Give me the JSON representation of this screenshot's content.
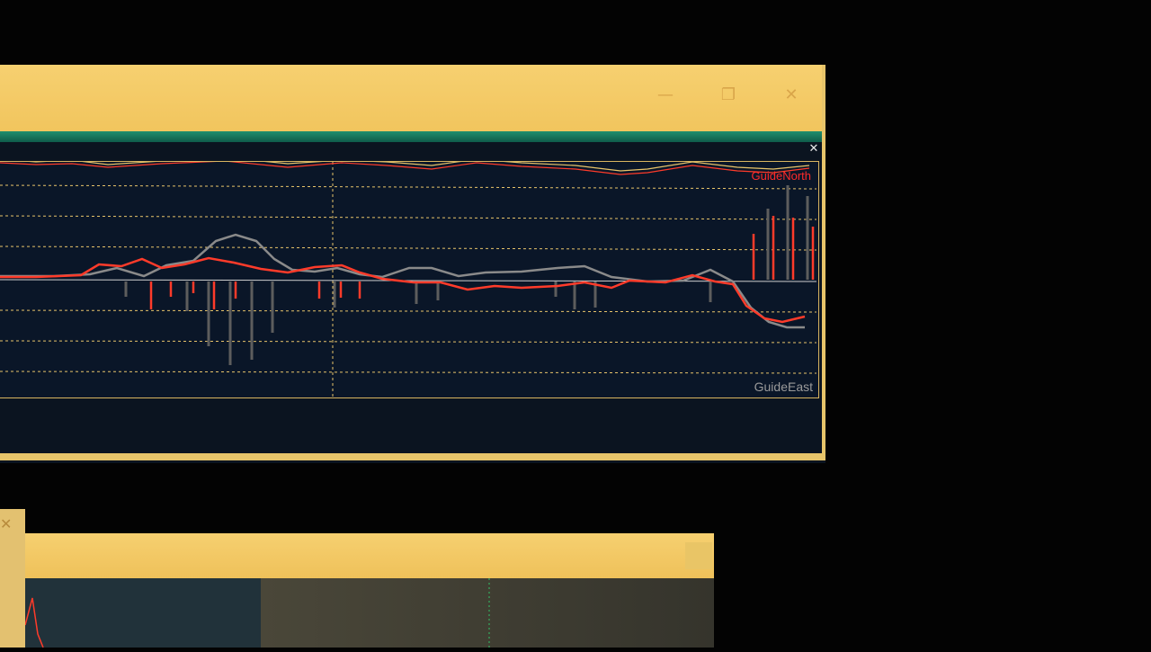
{
  "graph": {
    "legend_north": "GuideNorth",
    "legend_east": "GuideEast"
  },
  "titlebar": {
    "minimize_icon": "minimize-icon",
    "maximize_icon": "maximize-icon",
    "close_icon": "close-icon"
  },
  "panel": {
    "close_icon": "close-icon"
  },
  "colors": {
    "titlebar": "#f4cb68",
    "accent": "#1f8f6d",
    "north_series": "#ff3b2a",
    "east_series": "#8a8a8a",
    "grid": "#e8c46a"
  }
}
